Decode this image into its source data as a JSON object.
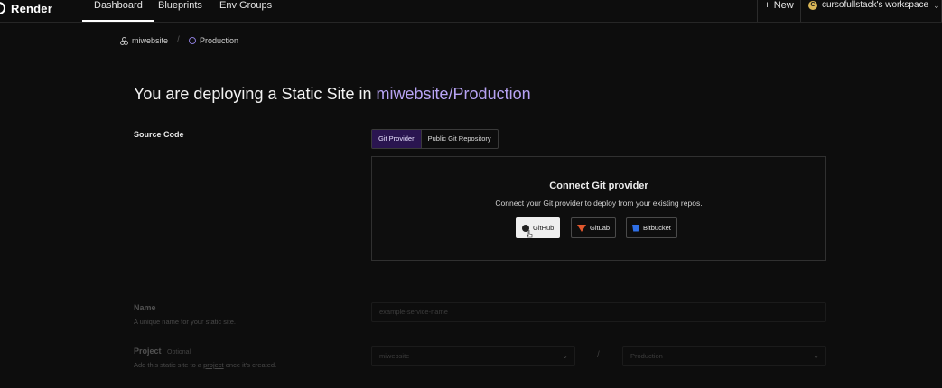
{
  "app": {
    "name": "Render"
  },
  "nav": {
    "dashboard": "Dashboard",
    "blueprints": "Blueprints",
    "env_groups": "Env Groups"
  },
  "top_right": {
    "new_label": "New",
    "workspace_initial": "C",
    "workspace_name": "cursofullstack's workspace"
  },
  "breadcrumb": {
    "project": "miwebsite",
    "separator": "/",
    "environment": "Production"
  },
  "heading": {
    "prefix": "You are deploying a Static Site in ",
    "target": "miwebsite/Production"
  },
  "source_code": {
    "label": "Source Code",
    "tabs": [
      "Git Provider",
      "Public Git Repository"
    ],
    "active_tab": "Git Provider",
    "panel_title": "Connect Git provider",
    "panel_subtitle": "Connect your Git provider to deploy from your existing repos.",
    "providers": [
      "GitHub",
      "GitLab",
      "Bitbucket"
    ]
  },
  "name_field": {
    "label": "Name",
    "help": "A unique name for your static site.",
    "placeholder": "example-service-name"
  },
  "project_field": {
    "label": "Project",
    "optional": "Optional",
    "help_prefix": "Add this static site to a ",
    "help_link": "project",
    "help_suffix": " once it's created.",
    "project_value": "miwebsite",
    "separator": "/",
    "environment_value": "Production"
  },
  "colors": {
    "accent": "#b7a3f3",
    "active_tab_bg": "#2a1550",
    "background": "#0d0d0d"
  }
}
